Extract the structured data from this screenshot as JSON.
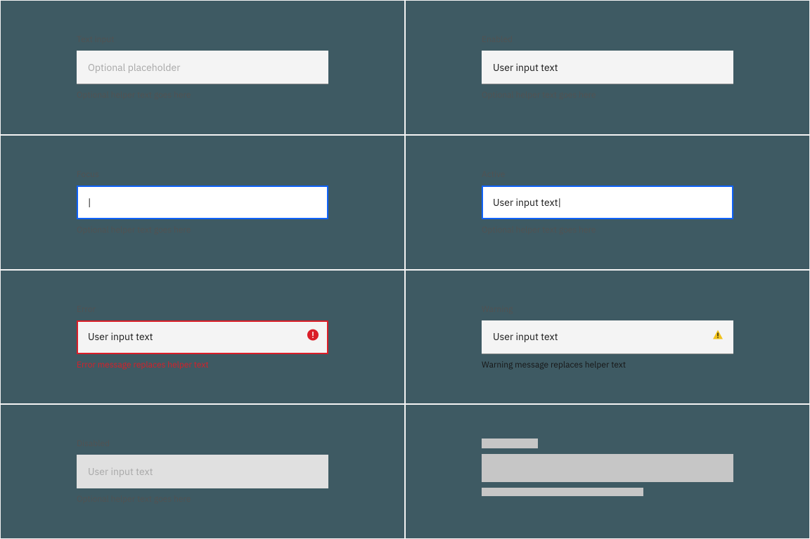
{
  "states": {
    "default": {
      "label": "Text input",
      "placeholder": "Optional placeholder",
      "helper": "Optional helper text goes here"
    },
    "enabled": {
      "label": "Enabled",
      "value": "User input text",
      "helper": "Optional helper text goes here"
    },
    "focus": {
      "label": "Focus",
      "value": "",
      "helper": "Optional helper text goes here"
    },
    "active": {
      "label": "Active",
      "value": "User input text",
      "helper": "Optional helper text goes here"
    },
    "error": {
      "label": "Error",
      "value": "User input text",
      "helper": "Error message replaces helper text",
      "icon": "error-filled-icon"
    },
    "warning": {
      "label": "Warning",
      "value": "User input text",
      "helper": "Warning message replaces helper text",
      "icon": "warning-filled-icon"
    },
    "disabled": {
      "label": "Disabled",
      "value": "User input text",
      "helper": "Optional helper text goes here"
    },
    "skeleton": {}
  },
  "colors": {
    "focus_outline": "#0f62fe",
    "error": "#da1e28",
    "warning_icon": "#f1c21b",
    "field_bg": "#f4f4f4",
    "text_primary": "#161616",
    "text_secondary": "#525252"
  }
}
